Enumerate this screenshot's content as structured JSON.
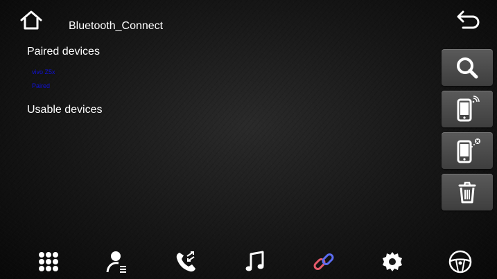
{
  "header": {
    "title": "Bluetooth_Connect"
  },
  "paired": {
    "heading": "Paired devices",
    "device_name": "vivo Z5x",
    "device_status": "Paired"
  },
  "usable": {
    "heading": "Usable devices"
  },
  "side_buttons": [
    "search-icon",
    "phone-broadcast-icon",
    "phone-disconnect-icon",
    "trash-icon"
  ],
  "bottom_nav": [
    "dialpad-icon",
    "contacts-icon",
    "call-log-icon",
    "music-icon",
    "link-icon",
    "settings-icon",
    "steering-wheel-icon"
  ],
  "colors": {
    "device_text": "#1010d8",
    "link_icon": "#5b6cf0",
    "link_icon_accent": "#e35a6a"
  }
}
